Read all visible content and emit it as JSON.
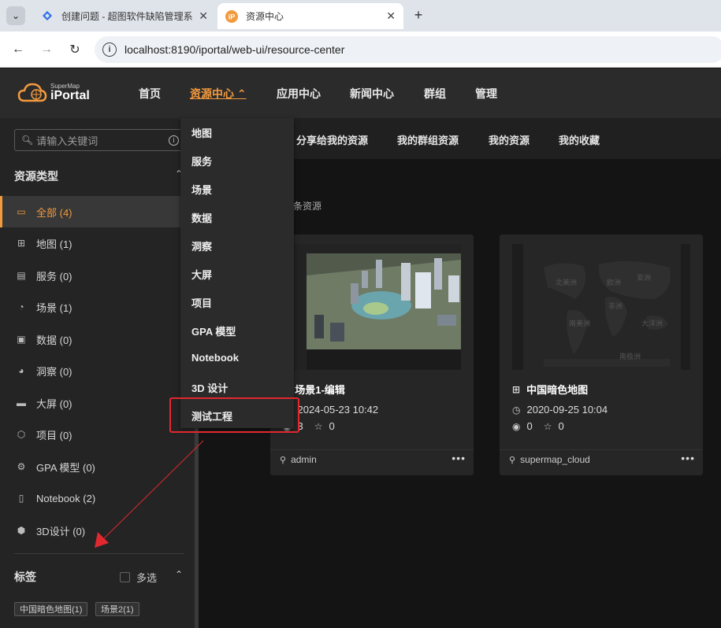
{
  "browser": {
    "tabs": [
      {
        "label": "创建问题 - 超图软件缺陷管理系",
        "active": false
      },
      {
        "label": "资源中心",
        "active": true
      }
    ],
    "url": "localhost:8190/iportal/web-ui/resource-center"
  },
  "header": {
    "logo_small": "SuperMap",
    "logo_big": "iPortal",
    "nav": [
      "首页",
      "资源中心",
      "应用中心",
      "新闻中心",
      "群组",
      "管理"
    ],
    "active_nav_index": 1
  },
  "sidebar": {
    "search_placeholder": "请输入关键词",
    "resource_type_title": "资源类型",
    "types": [
      {
        "label": "全部 (4)",
        "icon": "folder-icon",
        "selected": true
      },
      {
        "label": "地图 (1)",
        "icon": "map-icon"
      },
      {
        "label": "服务 (0)",
        "icon": "server-icon"
      },
      {
        "label": "场景 (1)",
        "icon": "scene-icon"
      },
      {
        "label": "数据 (0)",
        "icon": "data-icon"
      },
      {
        "label": "洞察 (0)",
        "icon": "insight-icon"
      },
      {
        "label": "大屏 (0)",
        "icon": "screen-icon"
      },
      {
        "label": "项目 (0)",
        "icon": "project-icon"
      },
      {
        "label": "GPA 模型 (0)",
        "icon": "gpa-icon"
      },
      {
        "label": "Notebook (2)",
        "icon": "notebook-icon"
      },
      {
        "label": "3D设计 (0)",
        "icon": "3d-design-icon"
      }
    ],
    "tags_title": "标签",
    "multi_select_label": "多选",
    "tags": [
      "中国暗色地图(1)",
      "场景2(1)"
    ]
  },
  "subnav": [
    "分享给我的资源",
    "我的群组资源",
    "我的资源",
    "我的收藏"
  ],
  "count_text": "条资源",
  "cards": [
    {
      "title": "场景1-编辑",
      "icon": "scene-icon",
      "date": "2024-05-23 10:42",
      "views": "3",
      "stars": "0",
      "owner": "admin"
    },
    {
      "title": "中国暗色地图",
      "icon": "map-icon",
      "date": "2020-09-25 10:04",
      "views": "0",
      "stars": "0",
      "owner": "supermap_cloud"
    }
  ],
  "dropdown": [
    "地图",
    "服务",
    "场景",
    "数据",
    "洞察",
    "大屏",
    "项目",
    "GPA 模型",
    "Notebook",
    "3D 设计",
    "测试工程"
  ],
  "map_labels": [
    "北美洲",
    "欧洲",
    "亚洲",
    "非洲",
    "南美洲",
    "大洋洲",
    "南极洲"
  ],
  "colors": {
    "accent": "#f39a3e",
    "annotation": "#e0282e"
  }
}
